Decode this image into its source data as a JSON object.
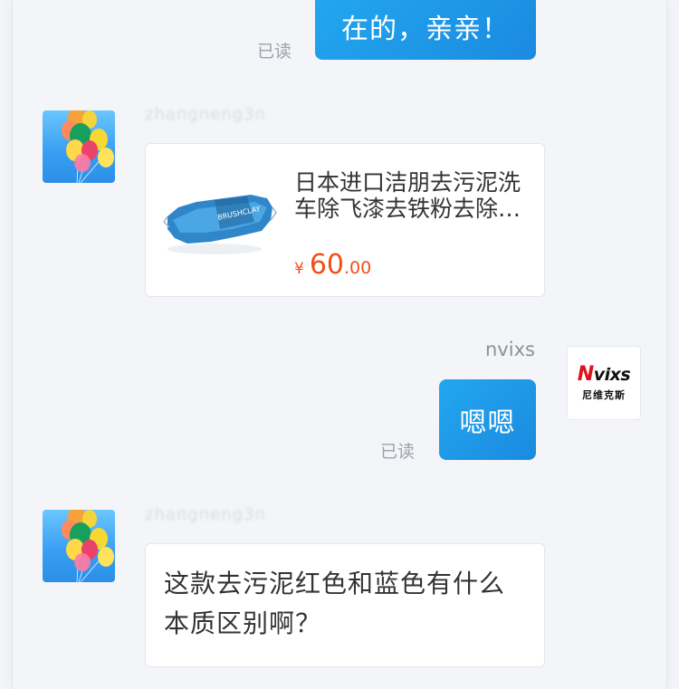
{
  "messages": [
    {
      "type": "sent",
      "text": "在的，亲亲！",
      "status": "已读"
    },
    {
      "type": "received_product",
      "sender": "zhangneng3n",
      "product": {
        "title": "日本进口洁朋去污泥洗车除飞漆去铁粉去除飞漆去铁粉",
        "price_currency": "¥",
        "price_int": "60",
        "price_dec": ".00"
      }
    },
    {
      "type": "sent",
      "sender": "nvixs",
      "text": "嗯嗯",
      "status": "已读",
      "avatar": {
        "logo_first": "N",
        "logo_rest": "vixs",
        "logo_sub": "尼维克斯"
      }
    },
    {
      "type": "received_text",
      "sender": "zhangneng3n",
      "text": "这款去污泥红色和蓝色有什么本质区别啊？"
    }
  ]
}
